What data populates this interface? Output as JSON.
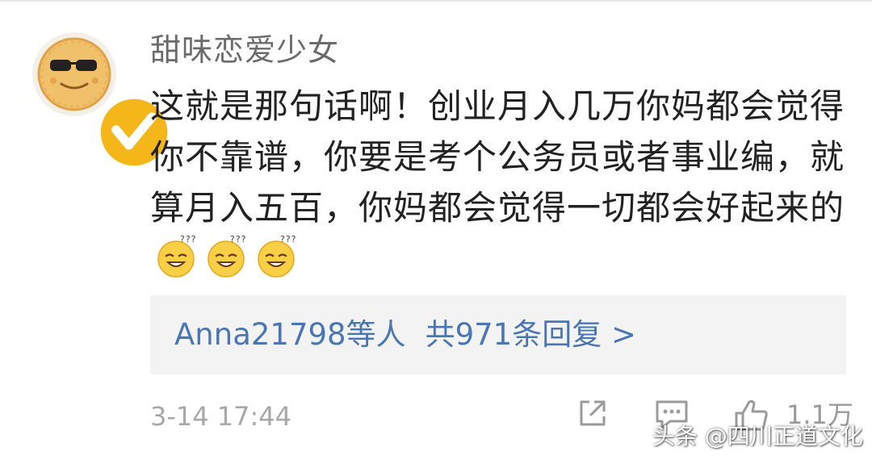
{
  "comment": {
    "username": "甜味恋爱少女",
    "text": "这就是那句话啊！创业月入几万你妈都会觉得你不靠谱，你要是考个公务员或者事业编，就算月入五百，你妈都会觉得一切都会好起来的",
    "emojis": [
      "wink-smile-emoji",
      "wink-smile-emoji",
      "wink-smile-emoji"
    ],
    "verified_badge": "verified-badge-icon"
  },
  "replies": {
    "names": "Anna21798等人",
    "total": "共971条回复 >"
  },
  "footer": {
    "timestamp": "3-14 17:44",
    "like_count": "1.1万"
  },
  "watermark": {
    "text": "头条 @四川正道文化"
  },
  "colors": {
    "link": "#4a77b3",
    "username": "#6b6b6b",
    "text": "#222222",
    "meta": "#a8a8a8",
    "reply_bg": "#f3f3f3",
    "badge": "#f5b61a"
  }
}
